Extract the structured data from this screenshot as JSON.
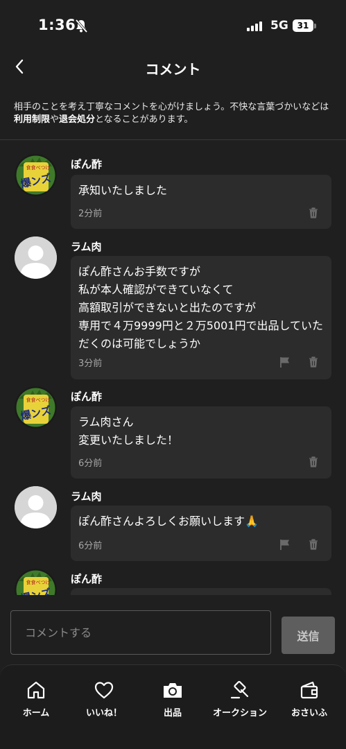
{
  "status": {
    "time": "1:36",
    "network": "5G",
    "battery": "31"
  },
  "header": {
    "title": "コメント"
  },
  "notice": {
    "part1": "相手のことを考え丁寧なコメントを心がけましょう。不快な言葉づかいなどは",
    "link1": "利用制限",
    "part2": "や",
    "link2": "退会処分",
    "part3": "となることがあります。"
  },
  "comments": [
    {
      "user": "ぽん酢",
      "text": "承知いたしました",
      "time": "2分前"
    },
    {
      "user": "ラム肉",
      "text": "ぽん酢さんお手数ですが\n私が本人確認ができていなくて\n高額取引ができないと出たのですが\n専用で４万9999円と２万5001円で出品していただくのは可能でしょうか",
      "time": "3分前"
    },
    {
      "user": "ぽん酢",
      "text": "ラム肉さん\n変更いたしました！",
      "time": "6分前"
    },
    {
      "user": "ラム肉",
      "text": "ぽん酢さんよろしくお願いします🙏",
      "time": "6分前"
    },
    {
      "user": "ぽん酢"
    }
  ],
  "avatar_text": "爆ンズ",
  "avatar_small": "食食べつけ",
  "input": {
    "placeholder": "コメントする",
    "send_label": "送信"
  },
  "tabs": [
    {
      "label": "ホーム",
      "icon": "home-icon"
    },
    {
      "label": "いいね！",
      "icon": "heart-icon"
    },
    {
      "label": "出品",
      "icon": "camera-icon"
    },
    {
      "label": "オークション",
      "icon": "gavel-icon"
    },
    {
      "label": "おさいふ",
      "icon": "wallet-icon"
    }
  ],
  "colors": {
    "background": "#1f1f1f",
    "bubble": "#2c2c2c",
    "send_disabled": "#5e5e5e"
  }
}
